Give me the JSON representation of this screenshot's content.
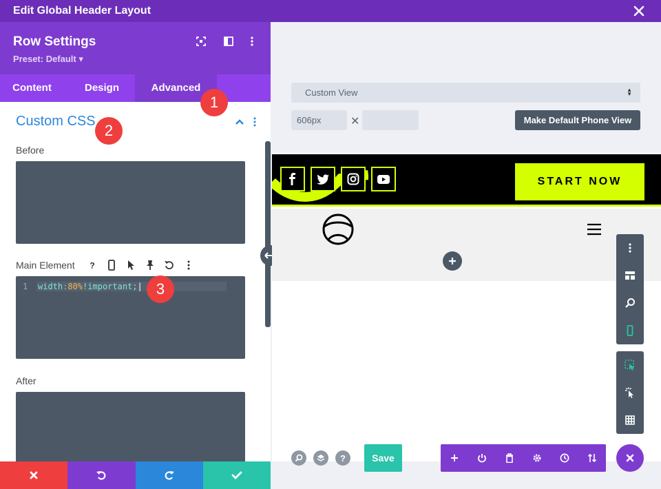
{
  "window": {
    "title": "Edit Global Header Layout"
  },
  "panel": {
    "title": "Row Settings",
    "preset": "Preset: Default ▾",
    "tabs": [
      "Content",
      "Design",
      "Advanced"
    ],
    "active_tab": "Advanced",
    "section_title": "Custom CSS",
    "before_label": "Before",
    "main_label": "Main Element",
    "after_label": "After",
    "code": {
      "line_number": "1",
      "property": "width",
      "colon": ":",
      "value": "80%",
      "important": "!important;"
    }
  },
  "badges": [
    "1",
    "2",
    "3"
  ],
  "viewport": {
    "select_value": "Custom View",
    "width_value": "606px",
    "height_value": "",
    "x_symbol": "✕",
    "make_default_label": "Make Default Phone View"
  },
  "preview": {
    "start_button": "START NOW",
    "social_icons": [
      "facebook-icon",
      "twitter-icon",
      "instagram-icon",
      "youtube-icon"
    ]
  },
  "bottom": {
    "save_label": "Save",
    "help": "?"
  },
  "colors": {
    "purple_dark": "#6c2eb9",
    "purple": "#7e3bd0",
    "accent_blue": "#2b87da",
    "lime": "#d4ff00",
    "teal": "#29c4a9",
    "red": "#ef3e3e"
  }
}
